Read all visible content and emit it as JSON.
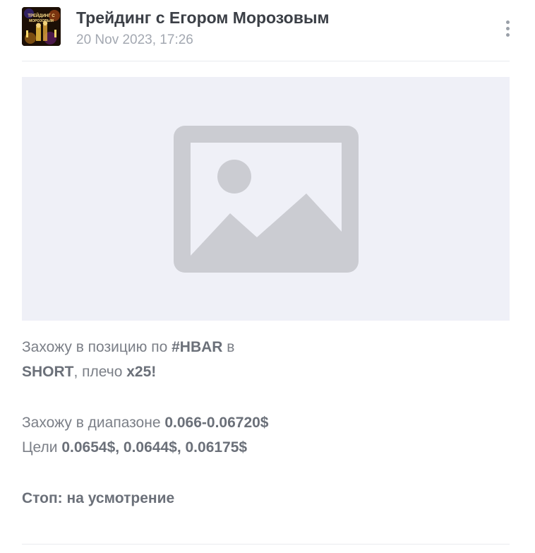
{
  "post": {
    "channel_name": "Трейдинг с Егором Морозовым",
    "date": "20 Nov 2023, 17:26",
    "avatar_caption": "ТРЕЙДИНГ С МОРОЗОВЫМ",
    "menu_icon": "more-vertical-icon",
    "media_icon": "image-placeholder-icon",
    "message": {
      "line1": {
        "t1": "Захожу в позицию по ",
        "b1": "#HBAR",
        "t2": " в"
      },
      "line2": {
        "b1": "SHORT",
        "t1": ", плечо ",
        "b2": "x25!"
      },
      "line3": {
        "t1": "Захожу в диапазоне ",
        "b1": "0.066-0.06720$"
      },
      "line4": {
        "t1": "Цели ",
        "b1": "0.0654$, 0.0644$, 0.06175$"
      },
      "line5": {
        "b1": "Стоп: на усмотрение"
      }
    }
  },
  "colors": {
    "title": "#3b3f46",
    "text": "#7b7f87",
    "date": "#a3a8b1",
    "placeholder_bg": "#eff0f7",
    "placeholder_icon": "#cbccd2"
  }
}
